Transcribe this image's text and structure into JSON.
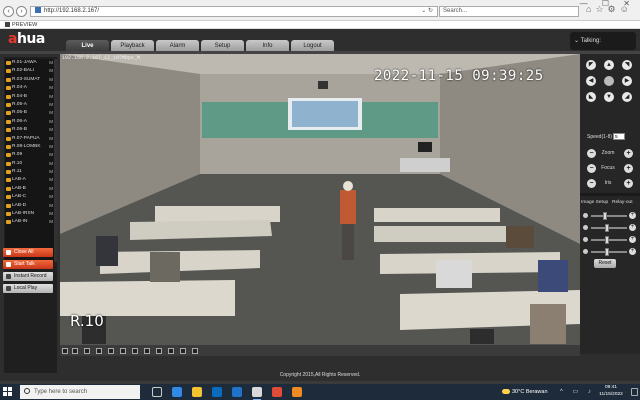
{
  "browser": {
    "url": "http://192.168.2.167/",
    "search_placeholder": "Search...",
    "tab_title": "PREVIEW",
    "win_controls": "—  ☐  ✕"
  },
  "app": {
    "logo_prefix": "a",
    "logo_suffix": "hua",
    "tabs": [
      "Live",
      "Playback",
      "Alarm",
      "Setup",
      "Info",
      "Logout"
    ],
    "active_tab": "Live",
    "talking_label": "Talking:"
  },
  "cameras": [
    "R.01-JAWA",
    "R.02-BALI",
    "R.03-SUMAT",
    "R.04-A",
    "R.04-B",
    "R.05-A",
    "R.05-B",
    "R.06-A",
    "R.06-B",
    "R.07-PAPUA",
    "R.08-LOMBK",
    "R.09",
    "R.10",
    "R.11",
    "LAB-A",
    "LAB-B",
    "LAB-C",
    "LAB-D",
    "LAB-IRSN",
    "LAB-IN"
  ],
  "camera_marker": "M",
  "left_buttons": {
    "close_all": "Close All",
    "start_talk": "Start Talk",
    "instant_record": "Instant Record",
    "local_play": "Local Play"
  },
  "video": {
    "stream_info": "192.168.2.167_12_16?Mbps_M",
    "timestamp": "2022-11-15  09:39:25",
    "camera_label": "R.10"
  },
  "ptz": {
    "speed_label": "Speed(1-8)",
    "speed_value": "5",
    "zoom_label": "Zoom",
    "focus_label": "Focus",
    "iris_label": "Iris"
  },
  "image_setup": {
    "tab1": "Image Setup",
    "tab2": "Relay-out",
    "reset_label": "Reset",
    "levels": [
      0.35,
      0.42,
      0.42,
      0.42
    ]
  },
  "footer": {
    "copyright": "Copyright 2015,All Rights Reserved."
  },
  "taskbar": {
    "search_placeholder": "Type here to search",
    "weather": "30°C  Berawan",
    "time": "09:41",
    "date": "11/15/2022"
  }
}
